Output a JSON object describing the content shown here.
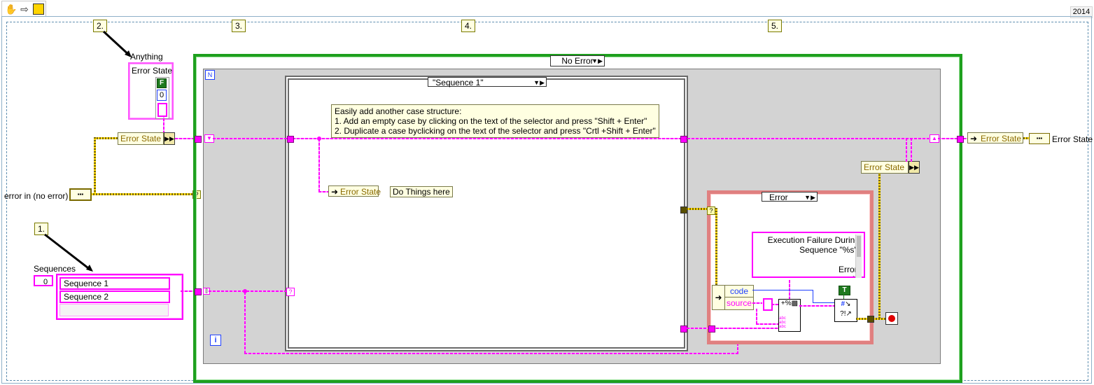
{
  "window": {
    "version": "2014"
  },
  "toolbar": {
    "hand_icon": "hand-icon",
    "arrow_icon": "arrow-icon",
    "labview_icon": "labview-icon"
  },
  "steps": {
    "s1": "1.",
    "s2": "2.",
    "s3": "3.",
    "s4": "4.",
    "s5": "5."
  },
  "controls": {
    "anything_label": "Anything",
    "error_state_cluster_label": "Error State",
    "error_state_bool": "F",
    "error_state_num": "0",
    "sequences_label": "Sequences",
    "sequences_index": "0",
    "sequences_items": [
      "Sequence 1",
      "Sequence 2"
    ],
    "error_in_label": "error in (no error)"
  },
  "structures": {
    "outer_case_selector": "No Error",
    "while_iteration": "i",
    "while_stop_icon": "N",
    "sequence_case_selector": "\"Sequence 1\"",
    "error_case_selector": "Error"
  },
  "nodes": {
    "unbundle_error_state": "Error State",
    "bundle_error_state_inner": "Error State",
    "do_things_here": "Do Things here",
    "bundle_error_state_right": "Error State",
    "output_error_state": "Error State",
    "indicator_error_state": "Error State",
    "code_label": "code",
    "source_label": "source",
    "format_string": "Execution Failure During\nSequence \"%s\".\n\nError:\n%",
    "true_constant": "T"
  },
  "comment": {
    "line1": "Easily add another case structure:",
    "line2": "1. Add an empty case by clicking on the text of the selector and press \"Shift + Enter\"",
    "line3": "2. Duplicate a case byclicking on the text of the selector and press \"Crtl +Shift + Enter\""
  },
  "colors": {
    "string_wire": "#ff00ff",
    "error_wire": "#ffd800",
    "structure_green": "#1ea01e",
    "error_case_red": "#e08080"
  }
}
